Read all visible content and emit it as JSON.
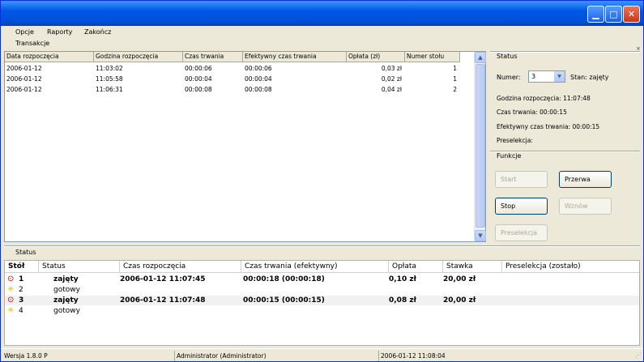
{
  "menu": {
    "items": [
      "Opcje",
      "Raporty",
      "Zakończ"
    ]
  },
  "transactions": {
    "group_label": "Transakcje",
    "columns": [
      "Data rozpoczęcia",
      "Godzina rozpoczęcia",
      "Czas trwania",
      "Efektywny czas trwania",
      "Opłata (zł)",
      "Numer stołu"
    ],
    "rows": [
      [
        "2006-01-12",
        "11:03:02",
        "00:00:06",
        "00:00:06",
        "0,03 zł",
        "1"
      ],
      [
        "2006-01-12",
        "11:05:58",
        "00:00:04",
        "00:00:04",
        "0,02 zł",
        "1"
      ],
      [
        "2006-01-12",
        "11:06:31",
        "00:00:08",
        "00:00:08",
        "0,04 zł",
        "2"
      ]
    ]
  },
  "status_panel": {
    "group_label": "Status",
    "numer_label": "Numer:",
    "numer_value": "3",
    "stan_label": "Stan: zajęty",
    "godzina_line": "Godzina rozpoczęcia: 11:07:48",
    "czas_line": "Czas trwania: 00:00:15",
    "efektywny_line": "Efektywny czas trwania: 00:00:15",
    "preselekcja_line": "Preselekcja:"
  },
  "functions": {
    "group_label": "Funkcje",
    "start": "Start",
    "przerwa": "Przerwa",
    "stop": "Stop",
    "wznow": "Wznów",
    "preselekcja": "Preselekcja"
  },
  "status_table": {
    "group_label": "Status",
    "columns": [
      "Stół",
      "Status",
      "Czas rozpoczęcia",
      "Czas trwania (efektywny)",
      "Opłata",
      "Stawka",
      "Preselekcja (zostało)"
    ],
    "rows": [
      {
        "stol": "1",
        "status": "zajęty",
        "start": "2006-01-12 11:07:45",
        "duration": "00:00:18 (00:00:18)",
        "fee": "0,10 zł",
        "rate": "20,00 zł",
        "icon": "clock-icon"
      },
      {
        "stol": "2",
        "status": "gotowy",
        "start": "",
        "duration": "",
        "fee": "",
        "rate": "",
        "icon": "sun-icon"
      },
      {
        "stol": "3",
        "status": "zajęty",
        "start": "2006-01-12 11:07:48",
        "duration": "00:00:15 (00:00:15)",
        "fee": "0,08 zł",
        "rate": "20,00 zł",
        "icon": "clock-icon"
      },
      {
        "stol": "4",
        "status": "gotowy",
        "start": "",
        "duration": "",
        "fee": "",
        "rate": "",
        "icon": "sun-icon"
      }
    ]
  },
  "statusbar": {
    "version": "Wersja 1.8.0 P",
    "user": "Administrator (Administrator)",
    "datetime": "2006-01-12 11:08:04"
  }
}
